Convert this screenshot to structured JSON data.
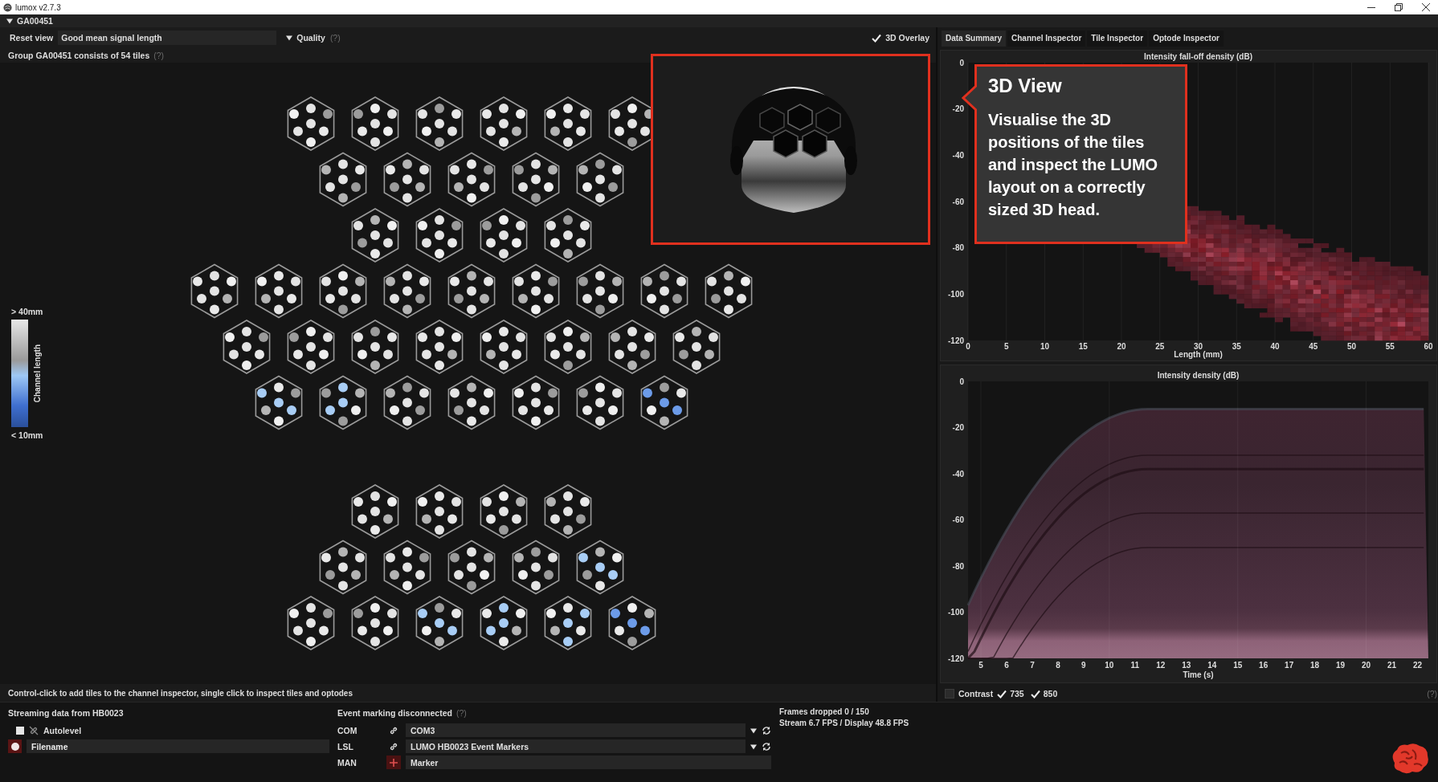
{
  "window": {
    "title": "lumox v2.7.3"
  },
  "group_header": {
    "label": "GA00451",
    "expanded": true
  },
  "toolbar": {
    "reset_button": "Reset view",
    "view_field": "Good mean signal length",
    "quality": {
      "label": "Quality",
      "help": "(?)",
      "expanded": true
    },
    "overlay": {
      "label": "3D Overlay",
      "checked": true
    }
  },
  "group_info": {
    "text": "Group GA00451 consists of 54 tiles",
    "help": "(?)"
  },
  "legend": {
    "max_label": "> 40mm",
    "title": "Channel length",
    "min_label": "< 10mm"
  },
  "tile_groups": [
    {
      "rows": [
        {
          "tiles": [
            {
              "color": "#e4e4e4"
            },
            {
              "color": "#e4e4e4"
            },
            {
              "color": "#e4e4e4"
            },
            {
              "color": "#e4e4e4"
            },
            {
              "color": "#e4e4e4"
            },
            {
              "color": "#e4e4e4"
            }
          ]
        },
        {
          "tiles": [
            {
              "color": "#e4e4e4"
            },
            {
              "color": "#e4e4e4"
            },
            {
              "color": "#e4e4e4"
            },
            {
              "color": "#e4e4e4"
            },
            {
              "color": "#e4e4e4"
            }
          ]
        },
        {
          "tiles": [
            {
              "color": "#e4e4e4"
            },
            {
              "color": "#e4e4e4"
            },
            {
              "color": "#e4e4e4"
            },
            {
              "color": "#e4e4e4"
            }
          ]
        },
        {
          "tiles": [
            {
              "color": "#e4e4e4"
            },
            {
              "color": "#e4e4e4"
            },
            {
              "color": "#e4e4e4"
            },
            {
              "color": "#e4e4e4"
            },
            {
              "color": "#e4e4e4"
            },
            {
              "color": "#e4e4e4"
            },
            {
              "color": "#e4e4e4"
            },
            {
              "color": "#e4e4e4"
            },
            {
              "color": "#e4e4e4"
            }
          ]
        },
        {
          "tiles": [
            {
              "color": "#e4e4e4"
            },
            {
              "color": "#e4e4e4"
            },
            {
              "color": "#e4e4e4"
            },
            {
              "color": "#e4e4e4"
            },
            {
              "color": "#e4e4e4"
            },
            {
              "color": "#e4e4e4"
            },
            {
              "color": "#e4e4e4"
            },
            {
              "color": "#e4e4e4"
            }
          ]
        },
        {
          "tiles": [
            {
              "color": "#a8cdf5"
            },
            {
              "color": "#a8cdf5"
            },
            {
              "color": "#e4e4e4"
            },
            {
              "color": "#e4e4e4"
            },
            {
              "color": "#e4e4e4"
            },
            {
              "color": "#e4e4e4"
            },
            {
              "color": "#6c9be8"
            }
          ]
        }
      ]
    },
    {
      "rows": [
        {
          "tiles": [
            {
              "color": "#e4e4e4"
            },
            {
              "color": "#e4e4e4"
            },
            {
              "color": "#e4e4e4"
            },
            {
              "color": "#e4e4e4"
            }
          ]
        },
        {
          "tiles": [
            {
              "color": "#e4e4e4"
            },
            {
              "color": "#e4e4e4"
            },
            {
              "color": "#e4e4e4"
            },
            {
              "color": "#e4e4e4"
            },
            {
              "color": "#a8cdf5"
            }
          ]
        },
        {
          "tiles": [
            {
              "color": "#e4e4e4"
            },
            {
              "color": "#e4e4e4"
            },
            {
              "color": "#a8cdf5"
            },
            {
              "color": "#a8cdf5"
            },
            {
              "color": "#a8cdf5"
            },
            {
              "color": "#6c9be8"
            }
          ]
        }
      ]
    }
  ],
  "hint": "Control-click to add tiles to the channel inspector, single click to inspect tiles and optodes",
  "callout": {
    "title": "3D View",
    "text": "Visualise the 3D positions of the tiles and inspect the LUMO layout on a correctly sized 3D head."
  },
  "tabs": [
    {
      "label": "Data Summary",
      "selected": true
    },
    {
      "label": "Channel Inspector",
      "selected": false
    },
    {
      "label": "Tile Inspector",
      "selected": false
    },
    {
      "label": "Optode Inspector",
      "selected": false
    }
  ],
  "charts": [
    {
      "kind": "heatmap",
      "title": "Intensity fall-off density (dB)",
      "xlabel": "Length (mm)",
      "xticks": [
        "0",
        "5",
        "10",
        "15",
        "20",
        "25",
        "30",
        "35",
        "40",
        "45",
        "50",
        "55",
        "60"
      ],
      "yticks": [
        "0",
        "-20",
        "-40",
        "-60",
        "-80",
        "-100",
        "-120"
      ]
    },
    {
      "kind": "density",
      "title": "Intensity density (dB)",
      "xlabel": "Time (s)",
      "xticks": [
        "5",
        "6",
        "7",
        "8",
        "9",
        "10",
        "11",
        "12",
        "13",
        "14",
        "15",
        "16",
        "17",
        "18",
        "19",
        "20",
        "21",
        "22"
      ],
      "yticks": [
        "0",
        "-20",
        "-40",
        "-60",
        "-80",
        "-100",
        "-120"
      ]
    }
  ],
  "contrast": {
    "label": "Contrast",
    "checked": false,
    "help": "(?)",
    "channels": [
      {
        "label": "735",
        "checked": true
      },
      {
        "label": "850",
        "checked": true
      }
    ]
  },
  "streaming": {
    "title": "Streaming data from HB0023",
    "autolevel": {
      "label": "Autolevel",
      "checked": false
    },
    "filename": {
      "placeholder": "Filename"
    }
  },
  "event_marking": {
    "title": "Event marking disconnected",
    "help": "(?)",
    "rows": [
      {
        "label": "COM",
        "kind": "select",
        "value": "COM3"
      },
      {
        "label": "LSL",
        "kind": "select",
        "value": "LUMO HB0023 Event Markers"
      },
      {
        "label": "MAN",
        "kind": "input",
        "value": "Marker"
      }
    ]
  },
  "stats": [
    "Frames dropped 0 / 150",
    "Stream 6.7 FPS / Display 48.8 FPS"
  ]
}
